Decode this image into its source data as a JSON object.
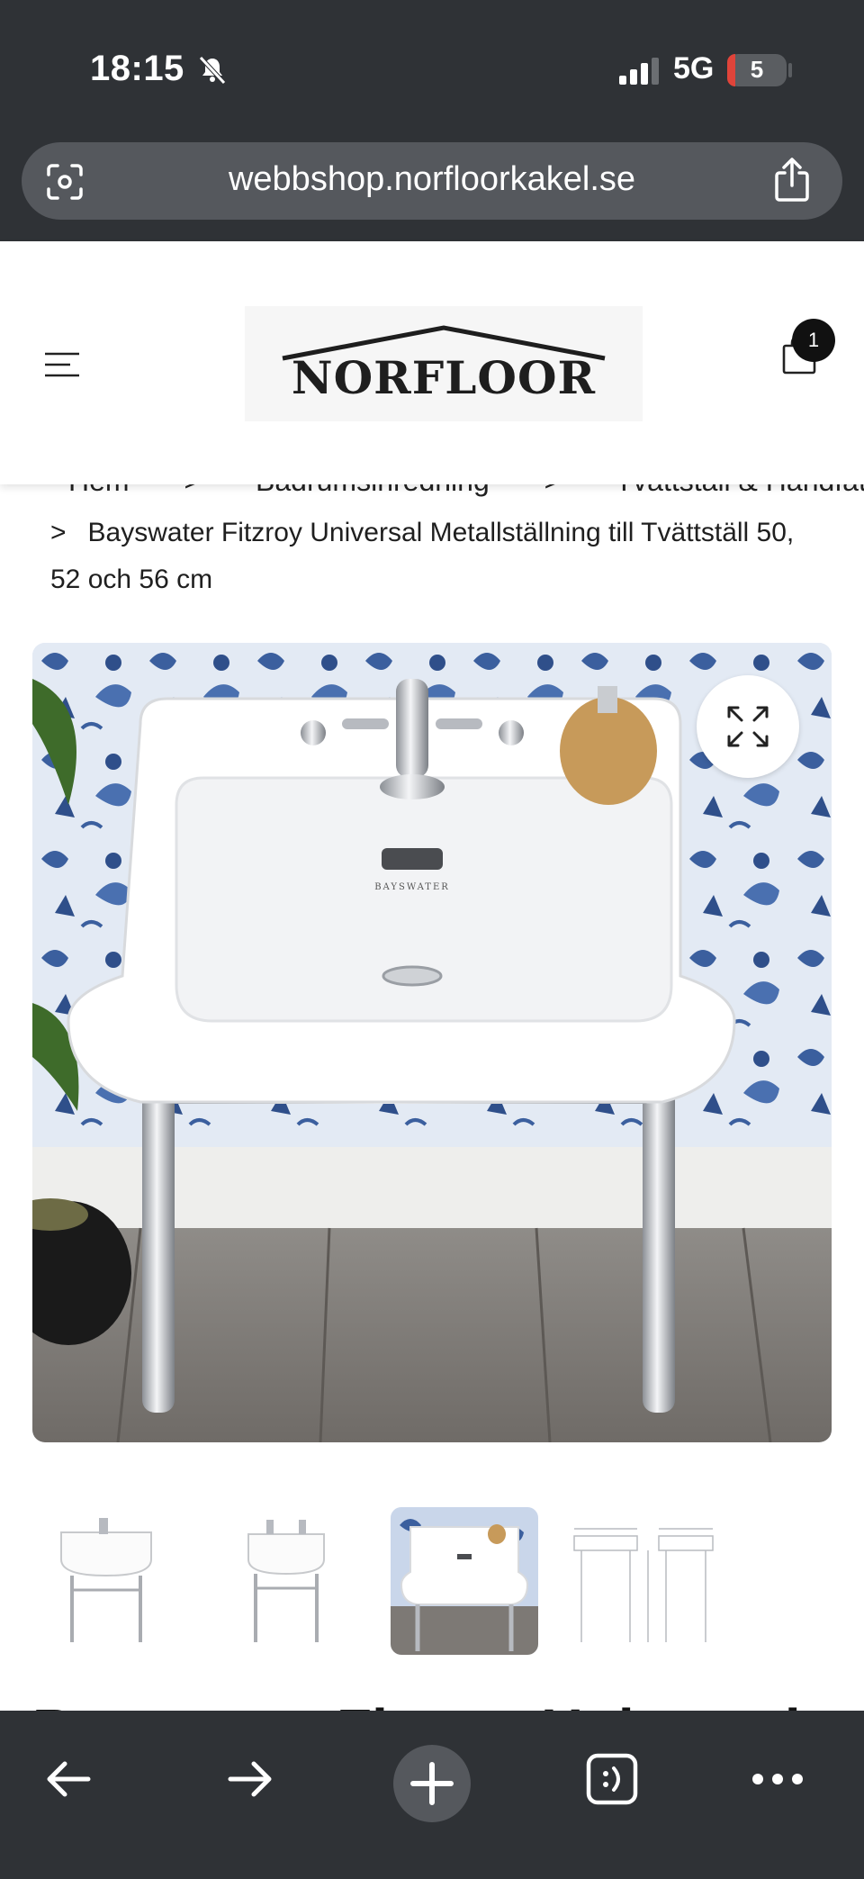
{
  "status_bar": {
    "time": "18:15",
    "network": "5G",
    "battery": "5"
  },
  "browser": {
    "url": "webbshop.norfloorkakel.se"
  },
  "header": {
    "logo_text": "NORFLOOR",
    "cart_count": "1"
  },
  "breadcrumb": {
    "items": [
      "Hem",
      "Badrumsinredning",
      "Tvättställ & Handfat"
    ],
    "separator": ">",
    "current": "Bayswater Fitzroy Universal Metallställning till Tvättställ 50, 52 och 56 cm"
  },
  "product": {
    "title_peek": "Bayswater Fitzroy Universal",
    "basin_brand": "BAYSWATER",
    "thumbnails": [
      {
        "name": "basin-stand-front",
        "active": false
      },
      {
        "name": "basin-stand-side",
        "active": false
      },
      {
        "name": "basin-lifestyle",
        "active": true
      },
      {
        "name": "technical-drawing",
        "active": false
      }
    ]
  },
  "colors": {
    "browser_chrome": "#2f3236",
    "url_pill": "#55585d",
    "battery_low": "#e0443a",
    "wallpaper_blue": "#3b5f9e"
  },
  "icons": {
    "menu": "hamburger-icon",
    "cart": "bag-icon",
    "expand": "expand-icon",
    "back": "arrow-left-icon",
    "forward": "arrow-right-icon",
    "new_tab": "plus-icon",
    "tabs": "tabs-icon",
    "more": "more-icon"
  }
}
